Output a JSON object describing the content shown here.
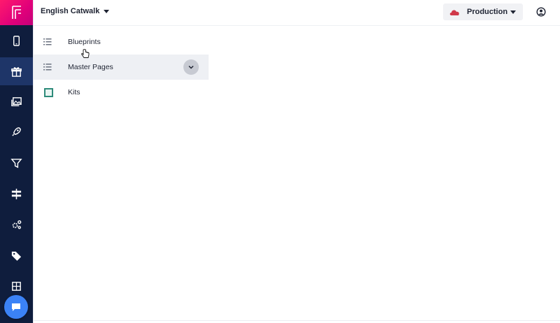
{
  "header": {
    "project_name": "English Catwalk",
    "environment": "Production"
  },
  "sidebar": {
    "items": [
      {
        "icon": "mobile-icon"
      },
      {
        "icon": "gift-box-icon",
        "active": true
      },
      {
        "icon": "media-library-icon"
      },
      {
        "icon": "rocket-icon"
      },
      {
        "icon": "filter-icon"
      },
      {
        "icon": "signpost-icon"
      },
      {
        "icon": "gears-icon"
      },
      {
        "icon": "tag-icon"
      },
      {
        "icon": "grid-icon"
      }
    ],
    "chat_icon": "chat-icon"
  },
  "list": {
    "items": [
      {
        "label": "Blueprints",
        "icon": "list-icon"
      },
      {
        "label": "Master Pages",
        "icon": "list-icon"
      },
      {
        "label": "Kits",
        "icon": "kit-square-icon"
      }
    ]
  },
  "colors": {
    "sidebar_bg": "#0f1d3d",
    "sidebar_active": "#1e3568",
    "logo_pink": "#e0007a",
    "kit_green": "#2e8b7a",
    "chat_blue": "#3b82f6",
    "cloud_red": "#d0394a"
  }
}
